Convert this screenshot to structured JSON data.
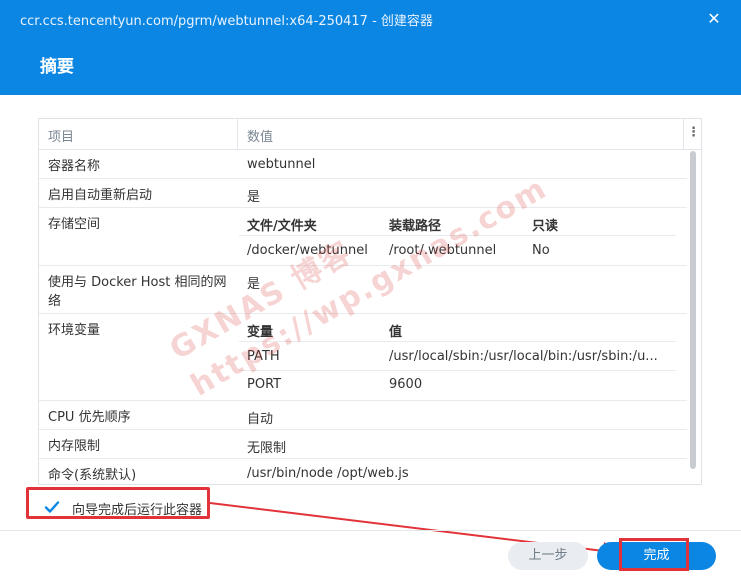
{
  "window": {
    "title": "ccr.ccs.tencentyun.com/pgrm/webtunnel:x64-250417 - 创建容器",
    "close_icon": "close-icon"
  },
  "page_title": "摘要",
  "table": {
    "headers": {
      "item": "项目",
      "value": "数值"
    },
    "rows": {
      "container_name": {
        "label": "容器名称",
        "value": "webtunnel"
      },
      "auto_restart": {
        "label": "启用自动重新启动",
        "value": "是"
      },
      "storage": {
        "label": "存储空间",
        "headers": [
          "文件/文件夹",
          "装载路径",
          "只读"
        ],
        "cells": [
          "/docker/webtunnel",
          "/root/.webtunnel",
          "No"
        ]
      },
      "same_network": {
        "label": "使用与 Docker Host 相同的网络",
        "value": "是"
      },
      "env": {
        "label": "环境变量",
        "headers": [
          "变量",
          "值"
        ],
        "items": [
          {
            "name": "PATH",
            "value": "/usr/local/sbin:/usr/local/bin:/usr/sbin:/u..."
          },
          {
            "name": "PORT",
            "value": "9600"
          }
        ]
      },
      "cpu_priority": {
        "label": "CPU 优先顺序",
        "value": "自动"
      },
      "memory_limit": {
        "label": "内存限制",
        "value": "无限制"
      },
      "command": {
        "label": "命令(系统默认)",
        "value": "/usr/bin/node /opt/web.js"
      }
    }
  },
  "watermark": {
    "line1": "GXNAS 博客",
    "line2": "https://wp.gxnas.com"
  },
  "run_after_wizard": {
    "label": "向导完成后运行此容器",
    "checked": true
  },
  "buttons": {
    "prev": "上一步",
    "done": "完成"
  },
  "colors": {
    "accent": "#0b86e3",
    "highlight": "#e2333a"
  }
}
